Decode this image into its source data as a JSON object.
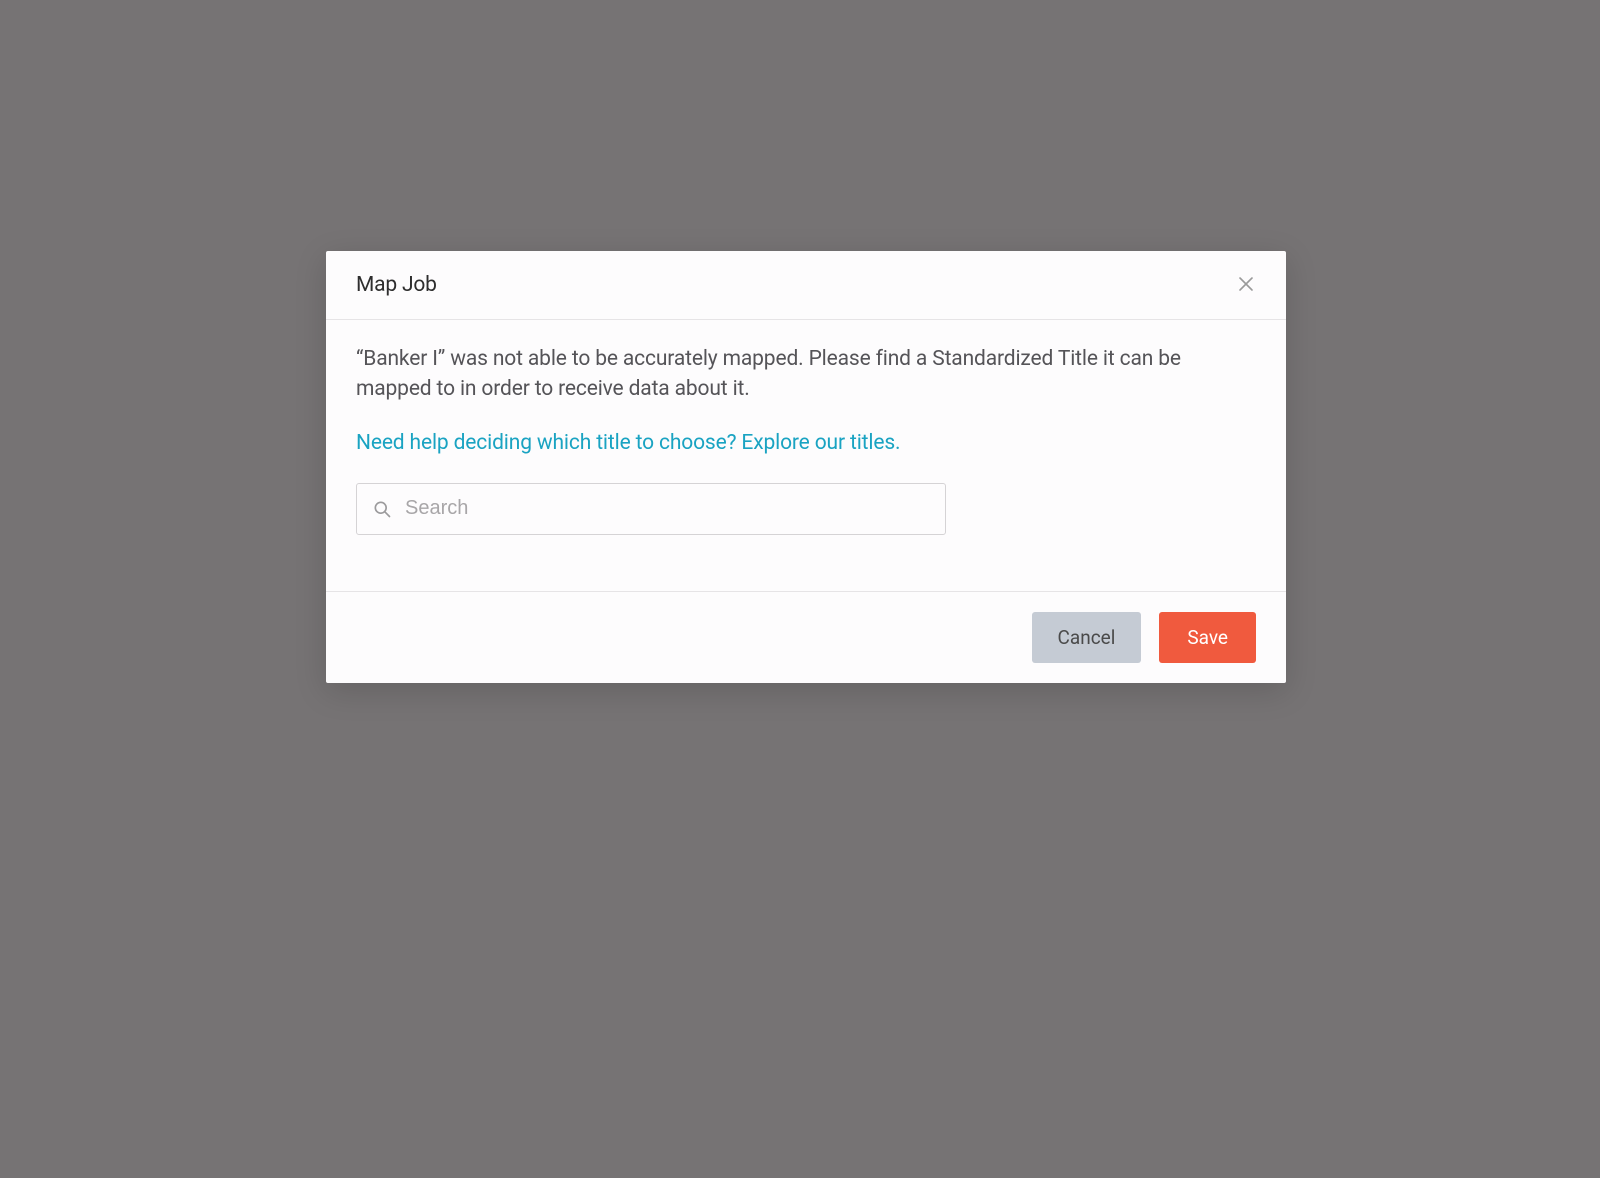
{
  "modal": {
    "title": "Map Job",
    "description": "“Banker I” was not able to be accurately mapped. Please find a Standardized Title it can be mapped to in order to receive data about it.",
    "help_link": "Need help deciding which title to choose? Explore our titles.",
    "search": {
      "placeholder": "Search",
      "value": ""
    },
    "footer": {
      "cancel_label": "Cancel",
      "save_label": "Save"
    }
  }
}
